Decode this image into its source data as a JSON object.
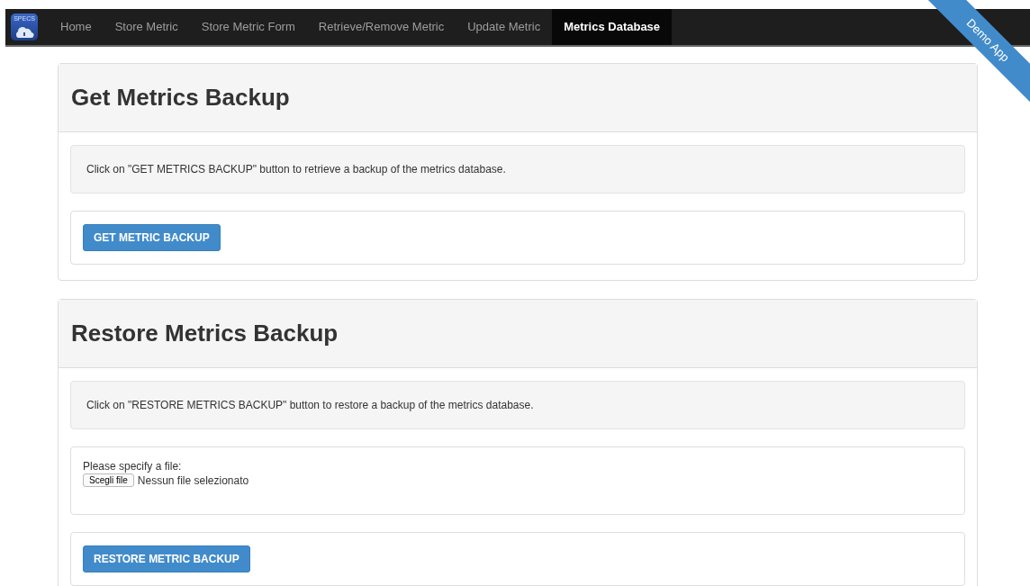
{
  "logo": {
    "text": "SPECS"
  },
  "nav": [
    {
      "label": "Home",
      "selected": false
    },
    {
      "label": "Store Metric",
      "selected": false
    },
    {
      "label": "Store Metric Form",
      "selected": false
    },
    {
      "label": "Retrieve/Remove Metric",
      "selected": false
    },
    {
      "label": "Update Metric",
      "selected": false
    },
    {
      "label": "Metrics Database",
      "selected": true
    }
  ],
  "ribbon": "Demo App",
  "panels": [
    {
      "title": "Get Metrics Backup",
      "info": "Click on \"GET METRICS BACKUP\" button to retrieve a backup of the metrics database.",
      "button": "GET METRIC BACKUP"
    },
    {
      "title": "Restore Metrics Backup",
      "info": "Click on \"RESTORE METRICS BACKUP\" button to restore a backup of the metrics database.",
      "file": {
        "label": "Please specify a file:",
        "button": "Scegli file",
        "status": "Nessun file selezionato"
      },
      "button": "RESTORE METRIC BACKUP"
    }
  ]
}
